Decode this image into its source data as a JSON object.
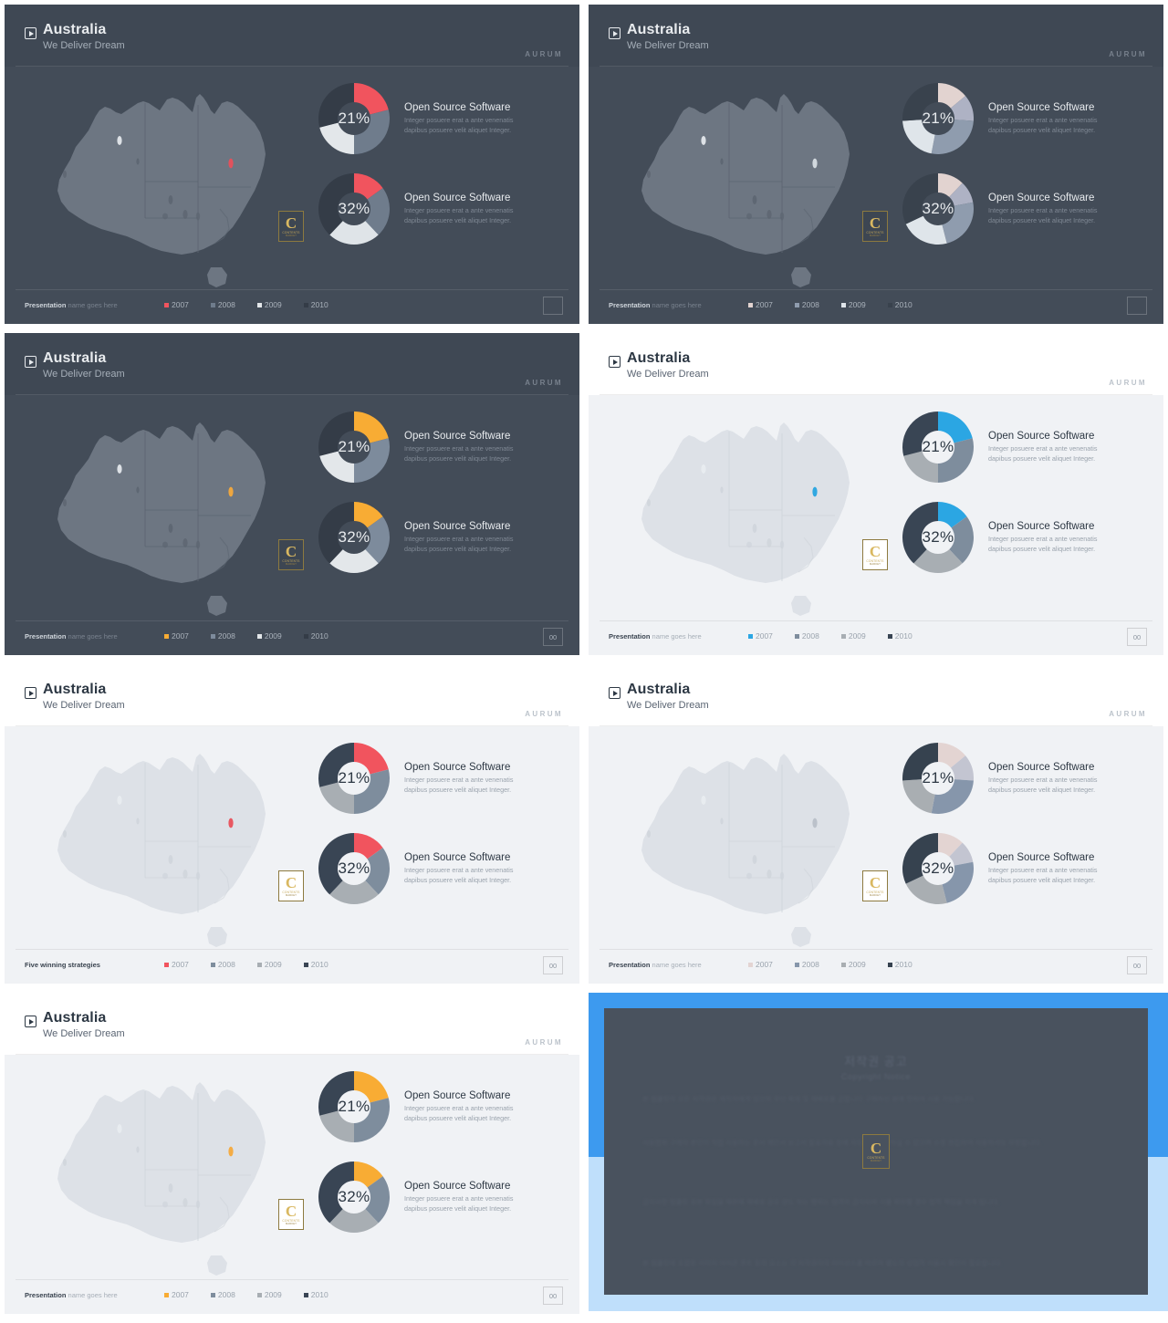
{
  "deck": {
    "brand": "AURUM",
    "title": "Australia",
    "subtitle": "We Deliver Dream",
    "play_icon": "play-icon",
    "logo": {
      "letter": "C",
      "line1": "CONTENTS",
      "line2": "MARKET"
    }
  },
  "panel_common": {
    "chart_title": "Open Source Software",
    "chart_body": "Integer posuere erat a ante venenatis dapibus posuere velit aliquet Integer.",
    "value_top": "21%",
    "value_bottom": "32%",
    "page_number": "00",
    "footer_bold": "Presentation",
    "footer_light": " name goes here",
    "footer_alt": "Five winning strategies"
  },
  "legend_years": [
    "2007",
    "2008",
    "2009",
    "2010"
  ],
  "chart_data": [
    {
      "type": "pie",
      "title": "Open Source Software",
      "center_label": "21%",
      "categories": [
        "2007",
        "2008",
        "2009",
        "2010"
      ],
      "values": [
        21,
        29,
        21,
        29
      ],
      "legend_position": "footer"
    },
    {
      "type": "pie",
      "title": "Open Source Software",
      "center_label": "32%",
      "categories": [
        "2007",
        "2008",
        "2009",
        "2010"
      ],
      "values": [
        15,
        23,
        24,
        38
      ],
      "legend_position": "footer"
    }
  ],
  "panels": [
    {
      "id": "panel-1",
      "theme": "dark-red",
      "bg": "#434c58",
      "header_bg": "#3f4854",
      "text": "#e8ebee",
      "sub": "#a5aeb8",
      "body_text": "#7f8894",
      "map_fill": "#6d7682",
      "map_stroke": "#5c6571",
      "pin": "#e8505b",
      "footer_label": "Presentation",
      "page_number": "",
      "slice_colors": [
        "#f1545e",
        "#6f7c8c",
        "#e3e7ea",
        "#343c47"
      ],
      "slice_colors_b": [
        "#f1545e",
        "#6f7c8c",
        "#dfe4e8",
        "#343c47"
      ]
    },
    {
      "id": "panel-2",
      "theme": "dark-muted",
      "bg": "#434c58",
      "header_bg": "#3f4854",
      "text": "#e8ebee",
      "sub": "#a5aeb8",
      "body_text": "#7f8894",
      "map_fill": "#6d7682",
      "map_stroke": "#5c6571",
      "pin": "#d7dde3",
      "footer_label": "Presentation",
      "page_number": "",
      "slice_colors": [
        "#e2d3d0",
        "#aeb2c4",
        "#8f9cae",
        "#dfe5ea",
        "#39424d"
      ],
      "slice_colors_b": [
        "#e2d3d0",
        "#aeb2c4",
        "#8f9cae",
        "#dfe5ea",
        "#39424d"
      ]
    },
    {
      "id": "panel-3",
      "theme": "dark-orange",
      "bg": "#434c58",
      "header_bg": "#3f4854",
      "text": "#e8ebee",
      "sub": "#a5aeb8",
      "body_text": "#7f8894",
      "map_fill": "#6d7682",
      "map_stroke": "#5c6571",
      "pin": "#f4a93c",
      "footer_label": "Presentation",
      "page_number": "00",
      "slice_colors": [
        "#f8ac34",
        "#7d8b9c",
        "#e3e7ea",
        "#343c47"
      ],
      "slice_colors_b": [
        "#f8ac34",
        "#7d8b9c",
        "#e3e7ea",
        "#343c47"
      ]
    },
    {
      "id": "panel-4",
      "theme": "light-blue",
      "bg": "#f0f2f5",
      "header_bg": "#ffffff",
      "text": "#2d3844",
      "sub": "#5a6472",
      "body_text": "#9aa3ad",
      "map_fill": "#dde1e7",
      "map_stroke": "#cfd4db",
      "pin": "#27a4e0",
      "footer_label": "Presentation",
      "page_number": "00",
      "slice_colors": [
        "#2ba6e3",
        "#7e8d9d",
        "#a8aeb3",
        "#394554"
      ],
      "slice_colors_b": [
        "#2ba6e3",
        "#7e8d9d",
        "#a8aeb3",
        "#394554"
      ]
    },
    {
      "id": "panel-5",
      "theme": "light-red",
      "bg": "#f0f2f5",
      "header_bg": "#ffffff",
      "text": "#2d3844",
      "sub": "#5a6472",
      "body_text": "#9aa3ad",
      "map_fill": "#dde1e7",
      "map_stroke": "#cfd4db",
      "pin": "#e8505b",
      "footer_label": "Five winning strategies",
      "page_number": "00",
      "slice_colors": [
        "#f1545e",
        "#7e8d9d",
        "#a8aeb3",
        "#394554"
      ],
      "slice_colors_b": [
        "#f1545e",
        "#7e8d9d",
        "#a8aeb3",
        "#394554"
      ]
    },
    {
      "id": "panel-6",
      "theme": "light-muted",
      "bg": "#f0f2f5",
      "header_bg": "#ffffff",
      "text": "#2d3844",
      "sub": "#5a6472",
      "body_text": "#9aa3ad",
      "map_fill": "#dde1e7",
      "map_stroke": "#cfd4db",
      "pin": "#b8bfc8",
      "footer_label": "Presentation",
      "page_number": "00",
      "slice_colors": [
        "#e3d4d2",
        "#c3c5d1",
        "#8696ab",
        "#a9aeb2",
        "#36424f"
      ],
      "slice_colors_b": [
        "#e3d4d2",
        "#c3c5d1",
        "#8696ab",
        "#a9aeb2",
        "#36424f"
      ]
    },
    {
      "id": "panel-7",
      "theme": "light-orange",
      "bg": "#f0f2f5",
      "header_bg": "#ffffff",
      "text": "#2d3844",
      "sub": "#5a6472",
      "body_text": "#9aa3ad",
      "map_fill": "#dde1e7",
      "map_stroke": "#cfd4db",
      "pin": "#f4a93c",
      "footer_label": "Presentation",
      "page_number": "00",
      "slice_colors": [
        "#f8ac34",
        "#7e8d9d",
        "#a8aeb3",
        "#394554"
      ],
      "slice_colors_b": [
        "#f8ac34",
        "#7e8d9d",
        "#a8aeb3",
        "#394554"
      ]
    }
  ],
  "copyright": {
    "title": "저작권 공고",
    "subtitle": "Copyright Notice",
    "paragraphs": [
      "본 템플릿의 모든 저작권은 제작자에게 있으며 무단 복제 및 재배포를 금합니다 구매하신 분에 한하여 사용 가능합니다.",
      "사용범위 구매자 본인이 직접 사용하는 문서 제안서 보고서 발표자료 등에 자유롭게 활용하실 수 있으며 수정 편집하여 사용하셔도 무방합니다.",
      "금지사항 템플릿 원본 파일을 재판매 재배포 공유 양도 하는 행위는 엄격히 금지되며 이를 위반할 경우 법적 책임을 지게 됩니다.",
      "본 템플릿에 포함된 이미지 아이콘 폰트 등의 요소는 각 저작권자의 라이선스를 따르며 별도의 상업적 이용시 확인이 필요합니다.",
      "문의사항이 있으시면 고객센터로 연락주시기 바랍니다."
    ],
    "bg_top": "#3d9aef",
    "bg_bottom": "#bfdffb"
  }
}
